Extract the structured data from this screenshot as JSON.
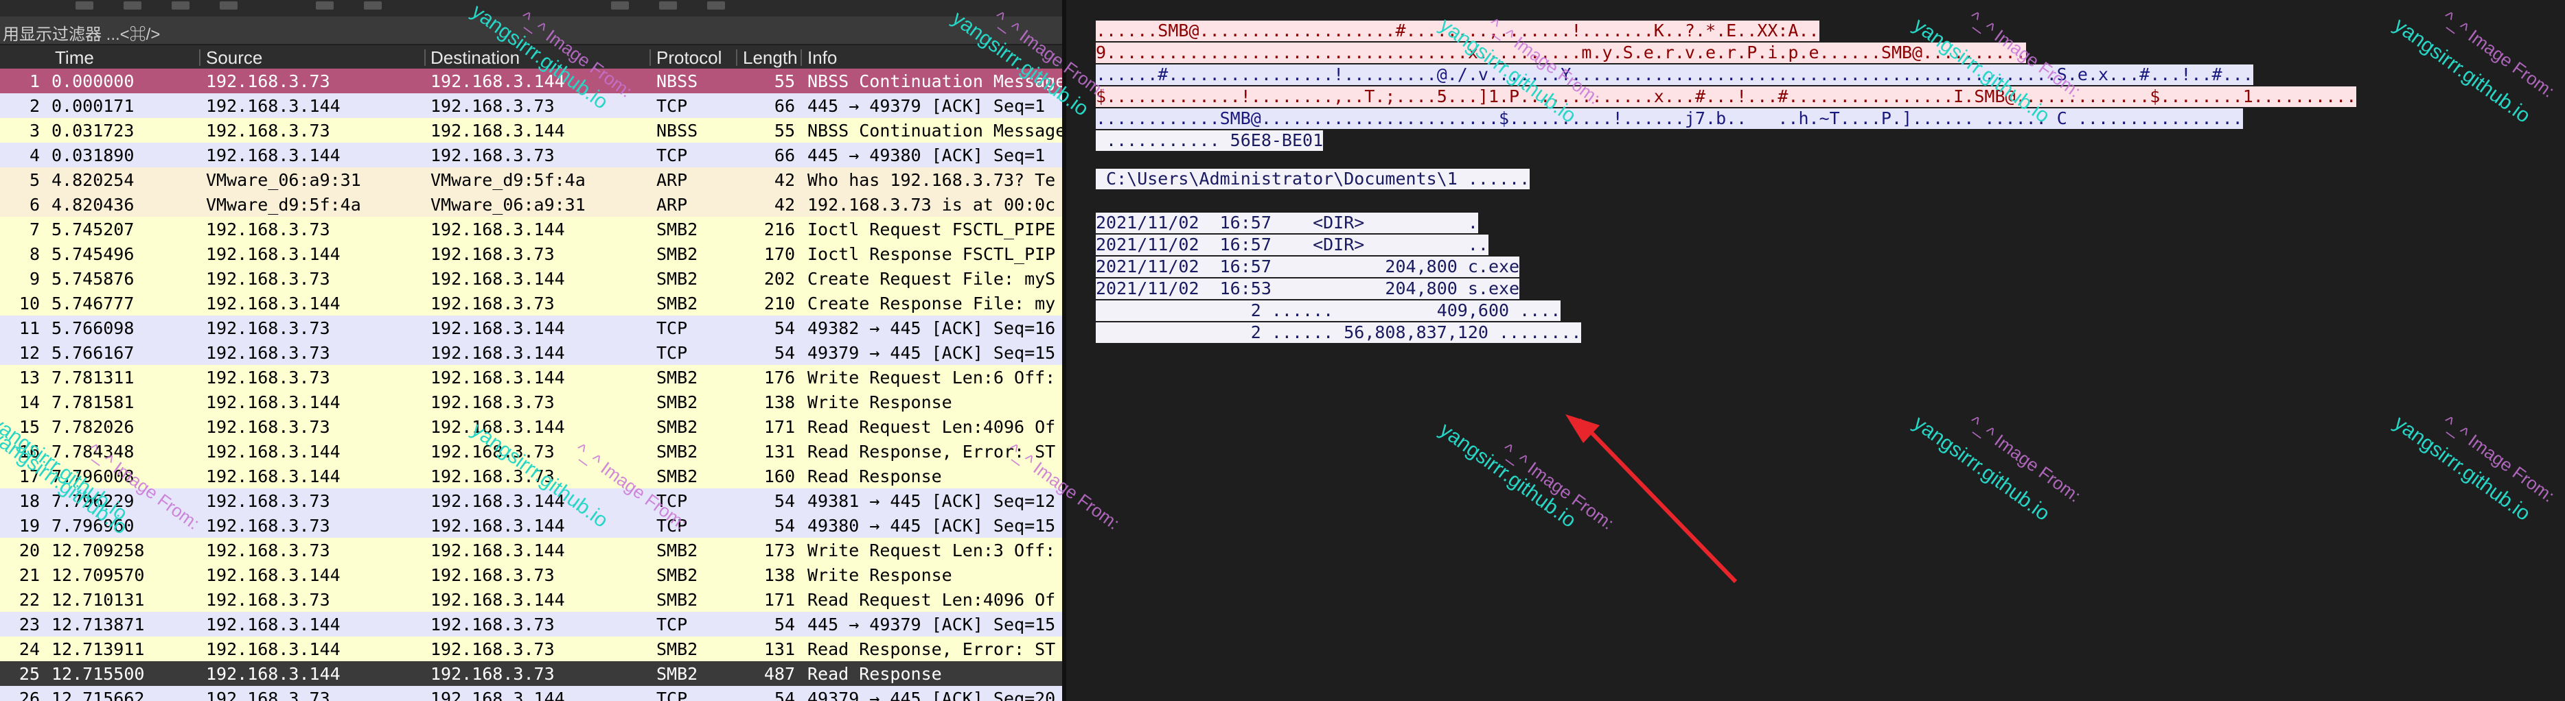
{
  "filter": {
    "placeholder": "用显示过滤器 ...<⌘/>"
  },
  "columns": {
    "time": "Time",
    "source": "Source",
    "destination": "Destination",
    "protocol": "Protocol",
    "length": "Length",
    "info": "Info"
  },
  "packets": [
    {
      "no": "1",
      "time": "0.000000",
      "src": "192.168.3.73",
      "dst": "192.168.3.144",
      "proto": "NBSS",
      "len": "55",
      "info": "NBSS Continuation Message",
      "color": "#b4547a",
      "fg": "#ffffff"
    },
    {
      "no": "2",
      "time": "0.000171",
      "src": "192.168.3.144",
      "dst": "192.168.3.73",
      "proto": "TCP",
      "len": "66",
      "info": "445 → 49379 [ACK] Seq=1",
      "color": "#e6e6fb",
      "fg": "#000000"
    },
    {
      "no": "3",
      "time": "0.031723",
      "src": "192.168.3.73",
      "dst": "192.168.3.144",
      "proto": "NBSS",
      "len": "55",
      "info": "NBSS Continuation Message",
      "color": "#feffd0",
      "fg": "#000000"
    },
    {
      "no": "4",
      "time": "0.031890",
      "src": "192.168.3.144",
      "dst": "192.168.3.73",
      "proto": "TCP",
      "len": "66",
      "info": "445 → 49380 [ACK] Seq=1",
      "color": "#e6e6fb",
      "fg": "#000000"
    },
    {
      "no": "5",
      "time": "4.820254",
      "src": "VMware_06:a9:31",
      "dst": "VMware_d9:5f:4a",
      "proto": "ARP",
      "len": "42",
      "info": "Who has 192.168.3.73? Te",
      "color": "#faf0d7",
      "fg": "#000000"
    },
    {
      "no": "6",
      "time": "4.820436",
      "src": "VMware_d9:5f:4a",
      "dst": "VMware_06:a9:31",
      "proto": "ARP",
      "len": "42",
      "info": "192.168.3.73 is at 00:0c",
      "color": "#faf0d7",
      "fg": "#000000"
    },
    {
      "no": "7",
      "time": "5.745207",
      "src": "192.168.3.73",
      "dst": "192.168.3.144",
      "proto": "SMB2",
      "len": "216",
      "info": "Ioctl Request FSCTL_PIPE",
      "color": "#feffd0",
      "fg": "#000000"
    },
    {
      "no": "8",
      "time": "5.745496",
      "src": "192.168.3.144",
      "dst": "192.168.3.73",
      "proto": "SMB2",
      "len": "170",
      "info": "Ioctl Response FSCTL_PIP",
      "color": "#feffd0",
      "fg": "#000000"
    },
    {
      "no": "9",
      "time": "5.745876",
      "src": "192.168.3.73",
      "dst": "192.168.3.144",
      "proto": "SMB2",
      "len": "202",
      "info": "Create Request File: myS",
      "color": "#feffd0",
      "fg": "#000000"
    },
    {
      "no": "10",
      "time": "5.746777",
      "src": "192.168.3.144",
      "dst": "192.168.3.73",
      "proto": "SMB2",
      "len": "210",
      "info": "Create Response File: my",
      "color": "#feffd0",
      "fg": "#000000"
    },
    {
      "no": "11",
      "time": "5.766098",
      "src": "192.168.3.73",
      "dst": "192.168.3.144",
      "proto": "TCP",
      "len": "54",
      "info": "49382 → 445 [ACK] Seq=16",
      "color": "#e6e6fb",
      "fg": "#000000"
    },
    {
      "no": "12",
      "time": "5.766167",
      "src": "192.168.3.73",
      "dst": "192.168.3.144",
      "proto": "TCP",
      "len": "54",
      "info": "49379 → 445 [ACK] Seq=15",
      "color": "#e6e6fb",
      "fg": "#000000"
    },
    {
      "no": "13",
      "time": "7.781311",
      "src": "192.168.3.73",
      "dst": "192.168.3.144",
      "proto": "SMB2",
      "len": "176",
      "info": "Write Request Len:6 Off:",
      "color": "#feffd0",
      "fg": "#000000"
    },
    {
      "no": "14",
      "time": "7.781581",
      "src": "192.168.3.144",
      "dst": "192.168.3.73",
      "proto": "SMB2",
      "len": "138",
      "info": "Write Response",
      "color": "#feffd0",
      "fg": "#000000"
    },
    {
      "no": "15",
      "time": "7.782026",
      "src": "192.168.3.73",
      "dst": "192.168.3.144",
      "proto": "SMB2",
      "len": "171",
      "info": "Read Request Len:4096 Of",
      "color": "#feffd0",
      "fg": "#000000"
    },
    {
      "no": "16",
      "time": "7.784348",
      "src": "192.168.3.144",
      "dst": "192.168.3.73",
      "proto": "SMB2",
      "len": "131",
      "info": "Read Response, Error: ST",
      "color": "#feffd0",
      "fg": "#000000"
    },
    {
      "no": "17",
      "time": "7.796008",
      "src": "192.168.3.144",
      "dst": "192.168.3.73",
      "proto": "SMB2",
      "len": "160",
      "info": "Read Response",
      "color": "#feffd0",
      "fg": "#000000"
    },
    {
      "no": "18",
      "time": "7.796229",
      "src": "192.168.3.73",
      "dst": "192.168.3.144",
      "proto": "TCP",
      "len": "54",
      "info": "49381 → 445 [ACK] Seq=12",
      "color": "#e6e6fb",
      "fg": "#000000"
    },
    {
      "no": "19",
      "time": "7.796960",
      "src": "192.168.3.73",
      "dst": "192.168.3.144",
      "proto": "TCP",
      "len": "54",
      "info": "49380 → 445 [ACK] Seq=15",
      "color": "#e6e6fb",
      "fg": "#000000"
    },
    {
      "no": "20",
      "time": "12.709258",
      "src": "192.168.3.73",
      "dst": "192.168.3.144",
      "proto": "SMB2",
      "len": "173",
      "info": "Write Request Len:3 Off:",
      "color": "#feffd0",
      "fg": "#000000"
    },
    {
      "no": "21",
      "time": "12.709570",
      "src": "192.168.3.144",
      "dst": "192.168.3.73",
      "proto": "SMB2",
      "len": "138",
      "info": "Write Response",
      "color": "#feffd0",
      "fg": "#000000"
    },
    {
      "no": "22",
      "time": "12.710131",
      "src": "192.168.3.73",
      "dst": "192.168.3.144",
      "proto": "SMB2",
      "len": "171",
      "info": "Read Request Len:4096 Of",
      "color": "#feffd0",
      "fg": "#000000"
    },
    {
      "no": "23",
      "time": "12.713871",
      "src": "192.168.3.144",
      "dst": "192.168.3.73",
      "proto": "TCP",
      "len": "54",
      "info": "445 → 49379 [ACK] Seq=15",
      "color": "#e6e6fb",
      "fg": "#000000"
    },
    {
      "no": "24",
      "time": "12.713911",
      "src": "192.168.3.144",
      "dst": "192.168.3.73",
      "proto": "SMB2",
      "len": "131",
      "info": "Read Response, Error: ST",
      "color": "#feffd0",
      "fg": "#000000"
    },
    {
      "no": "25",
      "time": "12.715500",
      "src": "192.168.3.144",
      "dst": "192.168.3.73",
      "proto": "SMB2",
      "len": "487",
      "info": "Read Response",
      "color": "#3a3a3a",
      "fg": "#ffffff"
    },
    {
      "no": "26",
      "time": "12.715662",
      "src": "192.168.3.73",
      "dst": "192.168.3.144",
      "proto": "TCP",
      "len": "54",
      "info": "49379 → 445 [ACK] Seq=20",
      "color": "#e6e6fb",
      "fg": "#000000"
    }
  ],
  "stream": {
    "hex_lines": [
      {
        "text": "......SMB@...................#........,.......!.......K..?.*.E..XX:A..",
        "style": "pink"
      },
      {
        "text": "9...................................x..........m.y.S.e.r.v.e.r.P.i.p.e......SMB@..........",
        "style": "pink"
      },
      {
        "text": "......#................!.........@./.v.......Y...............................................S.e.x...#...!..#...",
        "style": "blue"
      },
      {
        "text": "$.............!........,..T.;....5...]1.P.............x...#...!...#................I.SMB@.............$........1..........",
        "style": "pink"
      },
      {
        "text": "............SMB@.......................$..........!......j7.b..   ..h.~T....P.]...... ...... C ................",
        "style": "blue"
      },
      {
        "text": " ........... 56E8-BE01",
        "style": "white"
      }
    ],
    "path_line": " C:\\Users\\Administrator\\Documents\\1 ......",
    "dir_lines": [
      "2021/11/02  16:57    <DIR>          .",
      "2021/11/02  16:57    <DIR>          ..",
      "2021/11/02  16:57           204,800 c.exe",
      "2021/11/02  16:53           204,800 s.exe",
      "               2 ......          409,600 ....",
      "               2 ...... 56,808,837,120 ........"
    ]
  },
  "watermark": {
    "site": "yangsirrr.github.io",
    "from": "^_^ Image From:"
  },
  "annotation": {
    "arrow_color": "#e8252b"
  }
}
